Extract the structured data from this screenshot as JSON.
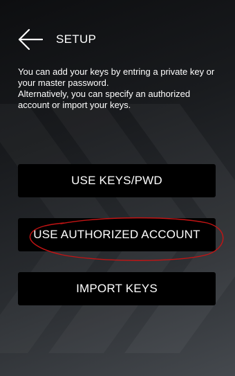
{
  "header": {
    "back_icon": "arrow-left-icon",
    "title": "SETUP"
  },
  "description": {
    "line1": "You can add your keys by entring a private key or your master password.",
    "line2": "Alternatively, you can specify an authorized account or import your keys."
  },
  "buttons": {
    "use_keys_label": "USE KEYS/PWD",
    "use_authorized_account_label": "USE AUTHORIZED ACCOUNT",
    "import_keys_label": "IMPORT KEYS"
  },
  "colors": {
    "button_bg": "#000000",
    "text": "#ffffff",
    "annotation_circle": "#c41414"
  }
}
